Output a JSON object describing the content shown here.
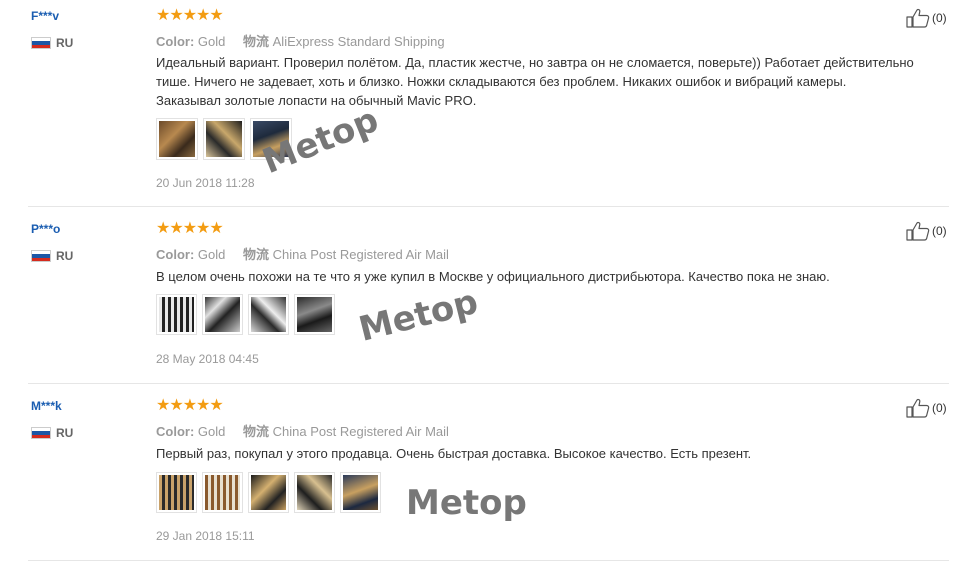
{
  "reviews": [
    {
      "user": "F***v",
      "country": "RU",
      "stars": "★★★★★",
      "color_label": "Color:",
      "color_value": "Gold",
      "ship_label": "物流",
      "ship_value": "AliExpress Standard Shipping",
      "text_lines": [
        "Идеальный вариант. Проверил полётом. Да, пластик жестче, но завтра он не сломается, поверьте)) Работает действительно",
        "тише. Ничего не задевает, хоть и близко. Ножки складываются без проблем. Никаких ошибок и вибраций камеры.",
        "Заказывал золотые лопасти на обычный Mavic PRO."
      ],
      "date": "20 Jun 2018 11:28",
      "likes": "(0)",
      "watermark": "Metop"
    },
    {
      "user": "P***o",
      "country": "RU",
      "stars": "★★★★★",
      "color_label": "Color:",
      "color_value": "Gold",
      "ship_label": "物流",
      "ship_value": "China Post Registered Air Mail",
      "text_lines": [
        "В целом очень похожи на те что я уже купил в Москве у официального дистрибьютора. Качество пока не знаю."
      ],
      "date": "28 May 2018 04:45",
      "likes": "(0)",
      "watermark": "Metop"
    },
    {
      "user": "M***k",
      "country": "RU",
      "stars": "★★★★★",
      "color_label": "Color:",
      "color_value": "Gold",
      "ship_label": "物流",
      "ship_value": "China Post Registered Air Mail",
      "text_lines": [
        "Первый раз, покупал у этого продавца. Очень быстрая доставка. Высокое качество. Есть презент."
      ],
      "date": "29 Jan 2018 15:11",
      "likes": "(0)",
      "watermark": "Metop"
    }
  ],
  "colors": {
    "username": "#1a5db1",
    "star": "#f39c12",
    "muted": "#999999"
  }
}
